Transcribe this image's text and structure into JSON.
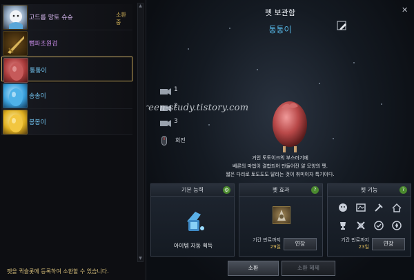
{
  "left_panel": {
    "pets": [
      {
        "name": "고드름 망토 슈슈",
        "status": "소환 중",
        "name_color": "#d7b8f0"
      },
      {
        "name": "뻠파초원검",
        "name_color": "#c78ae6"
      },
      {
        "name": "통통이",
        "name_color": "#72c3f0",
        "selected": true
      },
      {
        "name": "송송이",
        "name_color": "#72c3f0"
      },
      {
        "name": "봉봉이",
        "name_color": "#72c3f0"
      }
    ],
    "note": "펫을 퀵슬롯에 등록하여 소환할 수 있습니다."
  },
  "header": {
    "title": "펫 보관함",
    "pet_name": "통통이",
    "close_icon": "close-icon",
    "edit_icon": "edit-icon"
  },
  "camera": {
    "slots": [
      "1",
      "2",
      "3"
    ],
    "rotate_label": "회전"
  },
  "watermark": "green-study.tistory.com",
  "description": {
    "line1": "거인 토토이크의 부스러기에",
    "line2": "베론의 마법이 결합되어 만들어진 알 모양의 펫.",
    "line3": "짧은 다리로 토도도도 달리는 것이 취미이자 특기이다."
  },
  "boxes": {
    "basic": {
      "title": "기본 능력",
      "skill": "아이템 자동 획득"
    },
    "effect": {
      "title": "펫 효과",
      "period_label": "기간 만료까지",
      "days": "29일",
      "extend": "연장"
    },
    "function": {
      "title": "펫 기능",
      "period_label": "기간 만료까지",
      "days": "23일",
      "extend": "연장"
    }
  },
  "buttons": {
    "summon": "소환",
    "unsummon": "소환 해제"
  },
  "colors": {
    "accent_gold": "#d8b65a",
    "name_blue": "#56b7e6",
    "help_green": "#4b8a2e"
  }
}
